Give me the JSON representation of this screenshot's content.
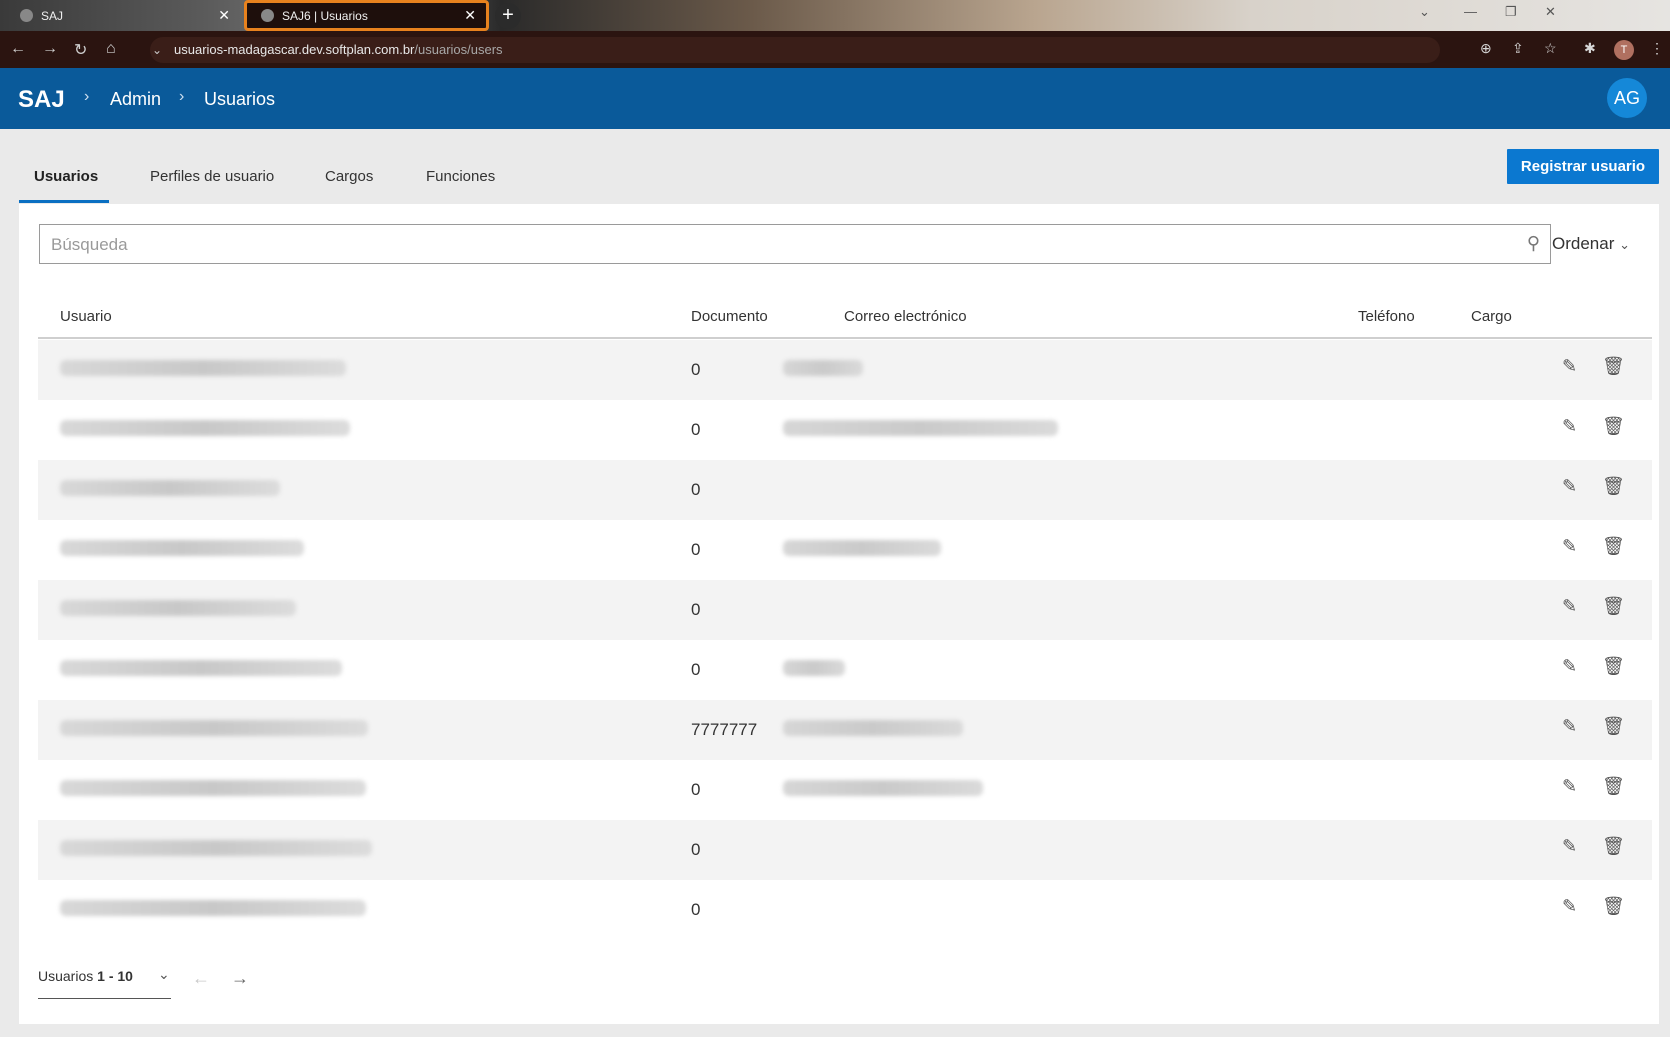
{
  "browser": {
    "tabs": [
      {
        "title": "SAJ",
        "active": false
      },
      {
        "title": "SAJ6 | Usuarios",
        "active": true
      }
    ],
    "url_host": "usuarios-madagascar.dev.softplan.com.br",
    "url_path": "/usuarios/users",
    "profile_initial": "T"
  },
  "header": {
    "logo": "SAJ",
    "breadcrumbs": [
      "Admin",
      "Usuarios"
    ],
    "avatar": "AG"
  },
  "tabs": [
    {
      "label": "Usuarios",
      "selected": true
    },
    {
      "label": "Perfiles de usuario",
      "selected": false
    },
    {
      "label": "Cargos",
      "selected": false
    },
    {
      "label": "Funciones",
      "selected": false
    }
  ],
  "register_button": "Registrar usuario",
  "search": {
    "placeholder": "Búsqueda"
  },
  "sort_label": "Ordenar",
  "table": {
    "columns": [
      "Usuario",
      "Documento",
      "Correo electrónico",
      "Teléfono",
      "Cargo"
    ],
    "rows": [
      {
        "documento": "0"
      },
      {
        "documento": "0"
      },
      {
        "documento": "0"
      },
      {
        "documento": "0"
      },
      {
        "documento": "0"
      },
      {
        "documento": "0"
      },
      {
        "documento": "7777777"
      },
      {
        "documento": "0"
      },
      {
        "documento": "0"
      },
      {
        "documento": "0"
      }
    ]
  },
  "pager": {
    "label": "Usuarios",
    "range": "1 - 10"
  },
  "icons": {
    "edit": "pencil-icon",
    "delete": "trash-icon",
    "search": "search-icon"
  },
  "colors": {
    "header_bg": "#0a5a9a",
    "primary_button": "#0b78d0",
    "tab_underline": "#0a6fc2",
    "active_tab_outline": "#e8821e"
  }
}
